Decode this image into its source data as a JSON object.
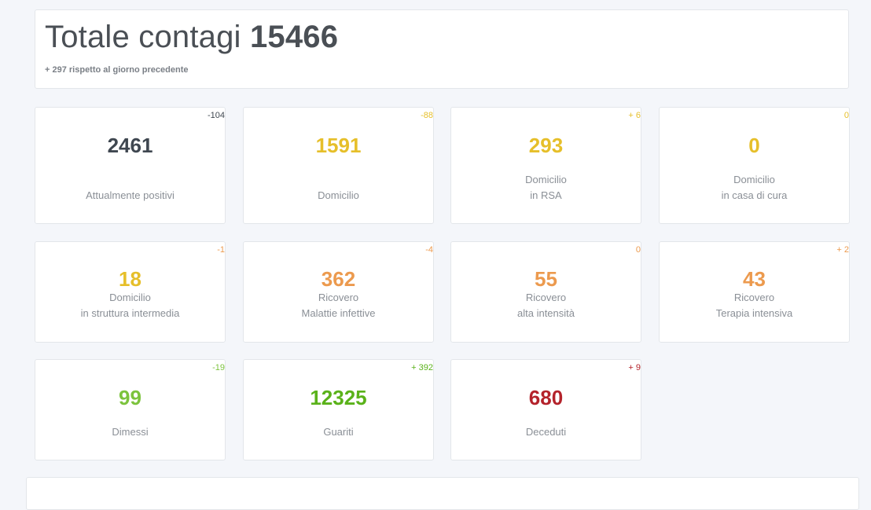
{
  "header": {
    "title_prefix": "Totale contagi",
    "total": "15466",
    "subtitle": "+ 297 rispetto al giorno precedente"
  },
  "colors": {
    "dark": "#3f4750",
    "yellow": "#e6bf2a",
    "orange": "#ec9a4e",
    "orange_delta": "#ec9a4e",
    "green": "#7cc33d",
    "green_dark": "#5ab21a",
    "red": "#b4232b",
    "label": "#8a8f96"
  },
  "cards": [
    {
      "value": "2461",
      "delta": "-104",
      "label1": "Attualmente positivi",
      "label2": ""
    },
    {
      "value": "1591",
      "delta": "-88",
      "label1": "Domicilio",
      "label2": ""
    },
    {
      "value": "293",
      "delta": "+ 6",
      "label1": "Domicilio",
      "label2": "in RSA"
    },
    {
      "value": "0",
      "delta": "0",
      "label1": "Domicilio",
      "label2": "in casa di cura"
    },
    {
      "value": "18",
      "delta": "-1",
      "label1": "Domicilio",
      "label2": "in struttura intermedia"
    },
    {
      "value": "362",
      "delta": "-4",
      "label1": "Ricovero",
      "label2": "Malattie infettive"
    },
    {
      "value": "55",
      "delta": "0",
      "label1": "Ricovero",
      "label2": "alta intensità"
    },
    {
      "value": "43",
      "delta": "+ 2",
      "label1": "Ricovero",
      "label2": "Terapia intensiva"
    },
    {
      "value": "99",
      "delta": "-19",
      "label1": "Dimessi",
      "label2": ""
    },
    {
      "value": "12325",
      "delta": "+ 392",
      "label1": "Guariti",
      "label2": ""
    },
    {
      "value": "680",
      "delta": "+ 9",
      "label1": "Deceduti",
      "label2": ""
    }
  ]
}
